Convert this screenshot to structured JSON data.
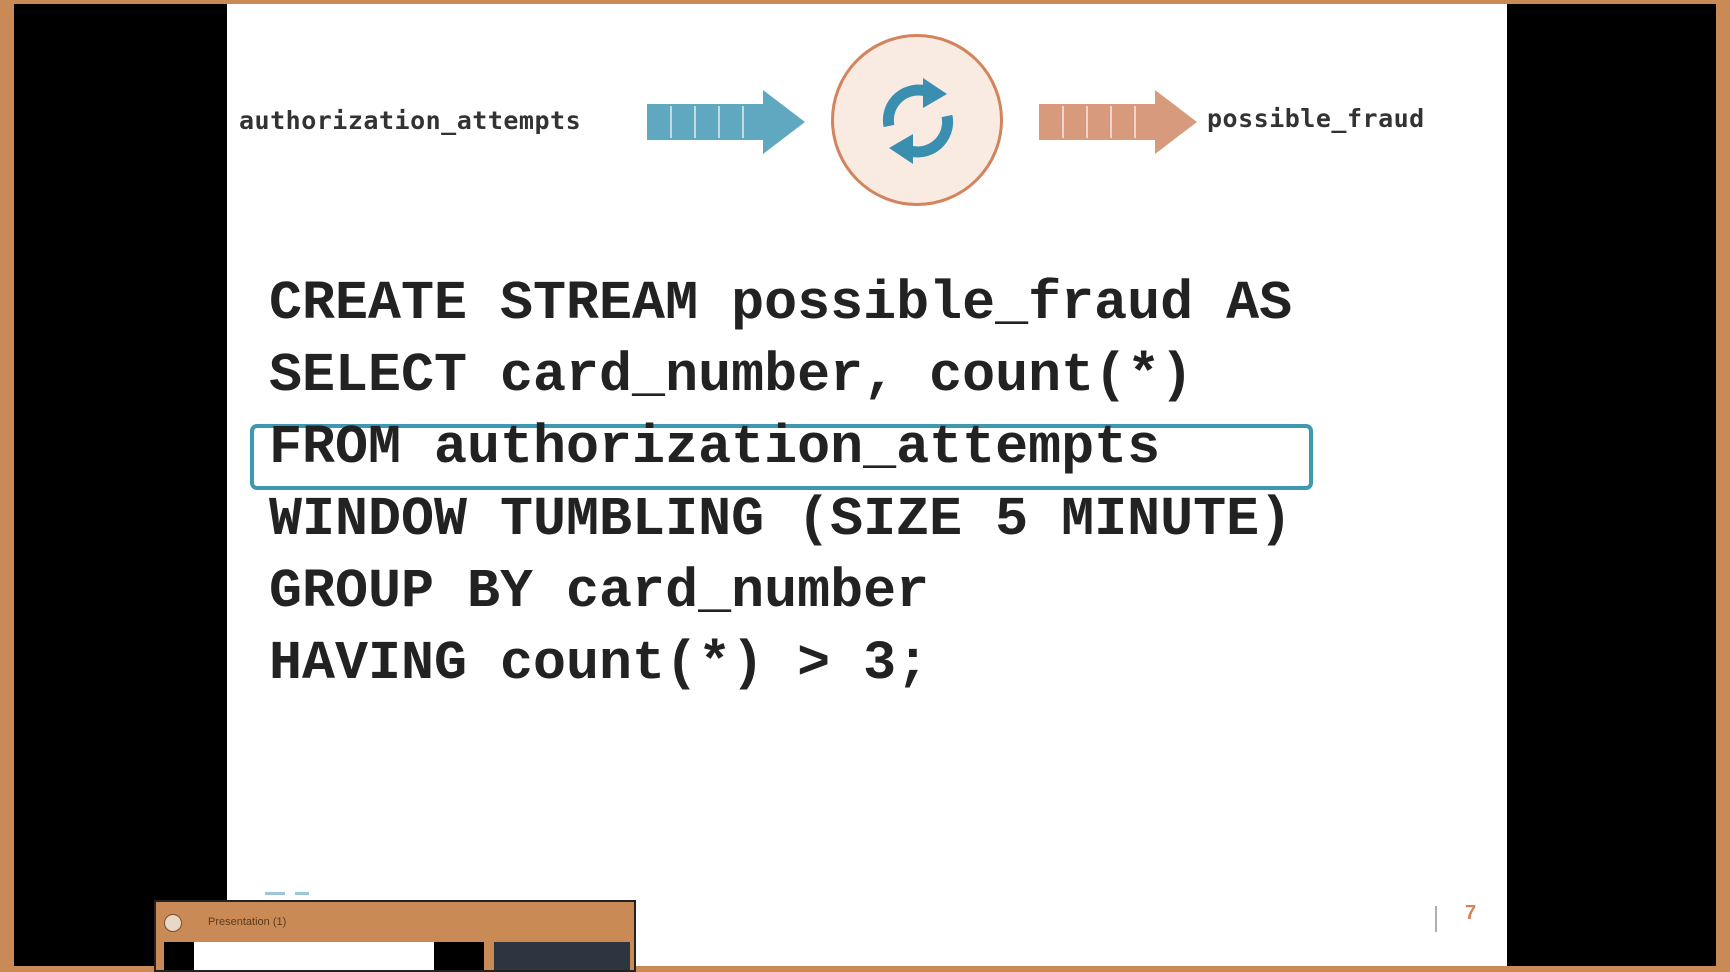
{
  "slide": {
    "input_stream": "authorization_attempts",
    "output_stream": "possible_fraud",
    "code_lines": [
      "CREATE STREAM possible_fraud AS",
      "SELECT card_number, count(*)",
      "FROM authorization_attempts",
      "WINDOW TUMBLING (SIZE 5 MINUTE)",
      "GROUP BY card_number",
      "HAVING count(*) > 3;"
    ],
    "highlighted_line": 2,
    "page_number": "7"
  },
  "taskbar_preview": {
    "title": "Presentation (1)"
  },
  "colors": {
    "input_arrow": "#5fa8c0",
    "output_arrow": "#d89a7c",
    "processor_border": "#d3845d",
    "processor_icon": "#3a8fb0",
    "highlight": "#3d98b0",
    "frame": "#c98a55"
  },
  "icons": {
    "processor": "refresh-cycle-icon",
    "input_arrow": "stream-arrow-icon",
    "output_arrow": "stream-arrow-icon"
  }
}
